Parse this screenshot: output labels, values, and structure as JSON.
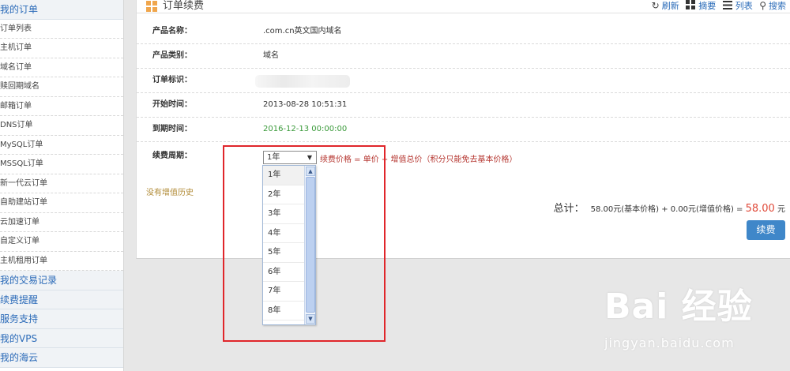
{
  "sidebar": {
    "head": "我的订单",
    "items": [
      "订单列表",
      "主机订单",
      "域名订单",
      "赎回期域名",
      "邮箱订单",
      "DNS订单",
      "MySQL订单",
      "MSSQL订单",
      "新一代云订单",
      "自助建站订单",
      "云加速订单",
      "自定义订单",
      "主机租用订单"
    ],
    "sections": [
      "我的交易记录",
      "续费提醒",
      "服务支持",
      "我的VPS",
      "我的海云"
    ]
  },
  "header": {
    "title": "订单续费",
    "toolbar": {
      "refresh": "刷新",
      "summary": "摘要",
      "list": "列表",
      "search": "搜索"
    }
  },
  "fields": {
    "product_name": {
      "label": "产品名称：",
      "value": ".com.cn英文国内域名"
    },
    "product_type": {
      "label": "产品类别：",
      "value": "域名"
    },
    "order_id": {
      "label": "订单标识："
    },
    "start_time": {
      "label": "开始时间：",
      "value": "2013-08-28 10:51:31"
    },
    "expire_time": {
      "label": "到期时间：",
      "value": "2016-12-13 00:00:00",
      "color": "#3a9a3a"
    }
  },
  "period": {
    "label": "续费周期：",
    "selected": "1年",
    "options": [
      "1年",
      "2年",
      "3年",
      "4年",
      "5年",
      "6年",
      "7年",
      "8年"
    ],
    "price_note": "续费价格 = 单价 + 增值总价（积分只能免去基本价格）"
  },
  "no_history": "没有增值历史",
  "total": {
    "label": "总计：",
    "formula": "58.00元(基本价格) + 0.00元(增值价格) = ",
    "amount": "58.00",
    "unit": "元"
  },
  "renew_button": "续费",
  "watermark": {
    "brand": "Bai 经验",
    "url": "jingyan.baidu.com"
  },
  "colors": {
    "accent": "#2b6cb9",
    "button": "#3f87c9",
    "highlight_box": "#e0262b",
    "price": "#e04a3a"
  }
}
